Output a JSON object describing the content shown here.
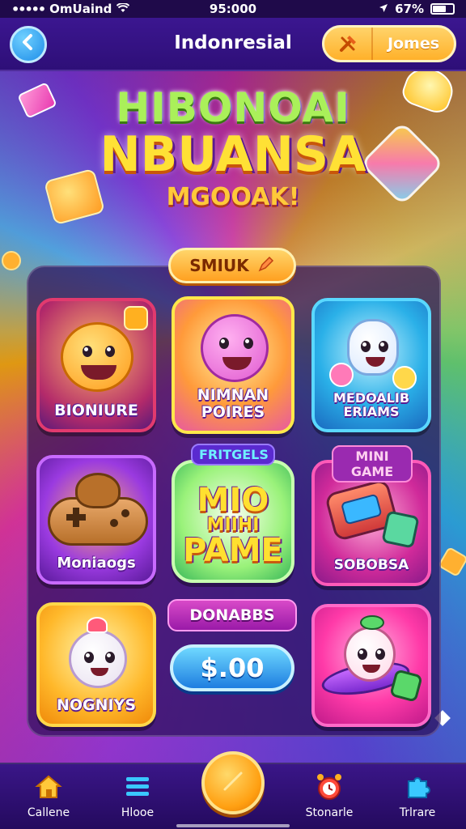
{
  "status_bar": {
    "signal": "•••••",
    "carrier": "OmUaind",
    "time": "95:000",
    "battery": "67%"
  },
  "header": {
    "back_icon": "chevron-left-icon",
    "title": "Indonresial",
    "games_label": "Jomes",
    "games_icon": "hammer-icon"
  },
  "hero": {
    "line1": "HIBONOAI",
    "line2": "NBUANSA",
    "line3": "MGOOAK!"
  },
  "smile_pill": {
    "label": "SMIUK",
    "icon": "pencil-icon"
  },
  "tiles": [
    {
      "label": "BIONIURE"
    },
    {
      "label_line1": "NIMNAN",
      "label_line2": "POIRES"
    },
    {
      "label_line1": "MEDOALIB",
      "label_line2": "ERIAMS"
    },
    {
      "label": "Moniaogs"
    },
    {
      "label_line1": "MIO",
      "label_line2": "MIIHI",
      "label_line3": "PAME"
    },
    {
      "label": "SOBOBSA"
    },
    {
      "label": "NOGNIYS"
    },
    {
      "label": ""
    }
  ],
  "badges": {
    "fritgels": "FRITGELS",
    "mini_game": "MINI GAME"
  },
  "donabbs": "DONABBS",
  "price": "$.00",
  "nav": [
    {
      "label": "Callene",
      "icon": "home-icon"
    },
    {
      "label": "Hlooe",
      "icon": "list-icon"
    },
    {
      "label": "",
      "icon": "coin-icon"
    },
    {
      "label": "Stonarle",
      "icon": "alarm-icon"
    },
    {
      "label": "Trlrare",
      "icon": "puzzle-icon"
    }
  ],
  "colors": {
    "accent_gold": "#ffb12a",
    "accent_blue": "#1e8de8",
    "panel_bg": "#2d0f5a",
    "title_yellow": "#ffe135",
    "title_green": "#aaf05a"
  }
}
